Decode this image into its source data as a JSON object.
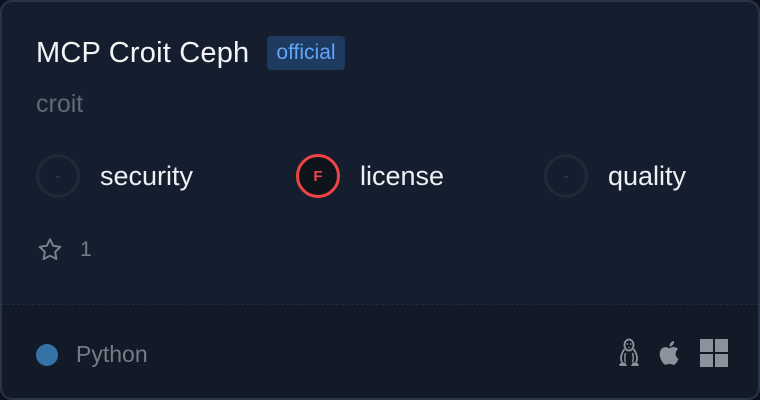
{
  "server": {
    "name": "MCP Croit Ceph",
    "badge": "official",
    "author": "croit"
  },
  "scores": [
    {
      "grade": "-",
      "label": "security",
      "status": "none"
    },
    {
      "grade": "F",
      "label": "license",
      "status": "fail"
    },
    {
      "grade": "-",
      "label": "quality",
      "status": "none"
    }
  ],
  "stars": {
    "count": "1",
    "icon": "star-icon"
  },
  "footer": {
    "language": "Python",
    "language_color": "#3572a5",
    "platforms": [
      "linux-icon",
      "apple-icon",
      "windows-icon"
    ]
  },
  "colors": {
    "card_bg": "#151e2e",
    "badge_bg": "#1e3a5f",
    "badge_text": "#60a5fa",
    "fail": "#ef4444"
  }
}
